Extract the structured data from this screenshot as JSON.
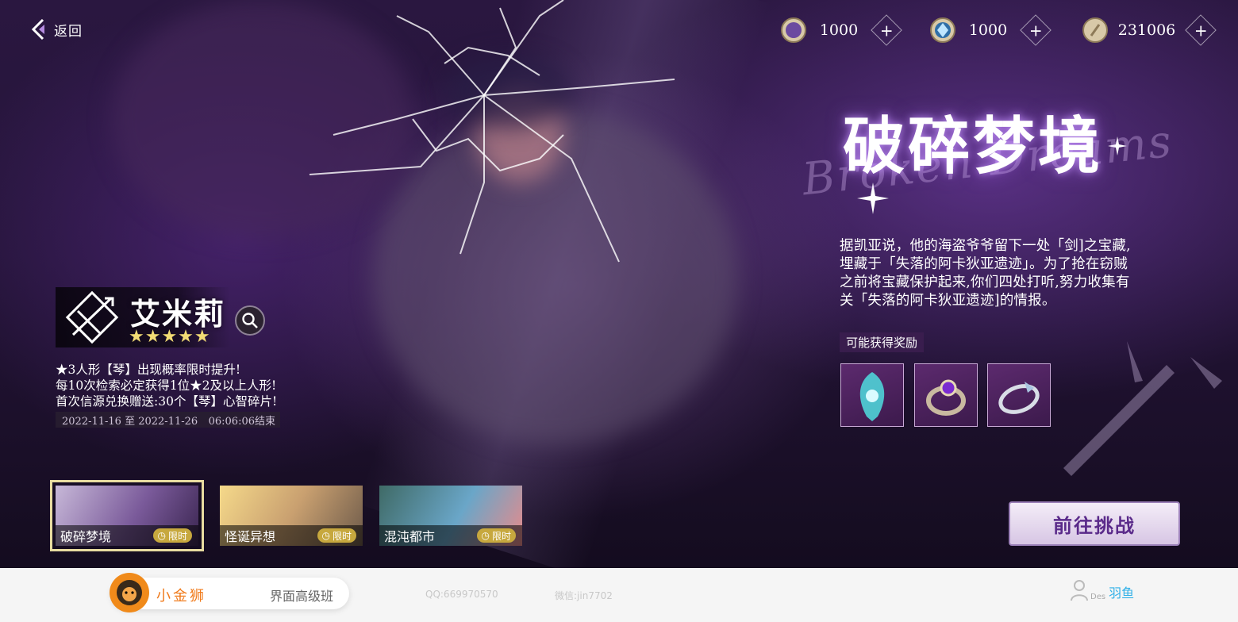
{
  "nav": {
    "back_label": "返回"
  },
  "currencies": [
    {
      "icon": "moon-coin-icon",
      "value": "1000"
    },
    {
      "icon": "crystal-coin-icon",
      "value": "1000"
    },
    {
      "icon": "gold-coin-icon",
      "value": "231006"
    }
  ],
  "banner": {
    "title": "破碎梦境",
    "title_script": "Broken Dreams",
    "description": "据凯亚说，他的海盗爷爷留下一处「剑]之宝藏,埋藏于「失落的阿卡狄亚遗迹」。为了抢在窃贼之前将宝藏保护起来,你们四处打听,努力收集有关「失落的阿卡狄亚遗迹]的情报。",
    "rewards_label": "可能获得奖励",
    "rewards": [
      "feather-gem-icon",
      "amethyst-ring-icon",
      "silver-ring-icon"
    ]
  },
  "character": {
    "name": "艾米莉",
    "stars": "★★★★★",
    "features": [
      "★3人形【琴】出现概率限时提升!",
      "每10次检索必定获得1位★2及以上人形!",
      "首次信源兑换赠送:30个【琴】心智碎片!"
    ],
    "period": "2022-11-16 至 2022-11-26",
    "countdown": "06:06:06结束"
  },
  "tabs": [
    {
      "name": "破碎梦境",
      "badge": "限时",
      "active": true
    },
    {
      "name": "怪诞异想",
      "badge": "限时",
      "active": false
    },
    {
      "name": "混沌都市",
      "badge": "限时",
      "active": false
    }
  ],
  "challenge_button": "前往挑战",
  "footer": {
    "brand": "小金狮",
    "course": "界面高级班",
    "qq": "QQ:669970570",
    "wechat": "微信:jin7702",
    "author_prefix": "Des",
    "author": "羽鱼"
  },
  "colors": {
    "accent_purple": "#5a2a8a",
    "badge_gold": "#c7a83e",
    "brand_orange": "#f07a1a",
    "author_blue": "#2fb0e8"
  }
}
